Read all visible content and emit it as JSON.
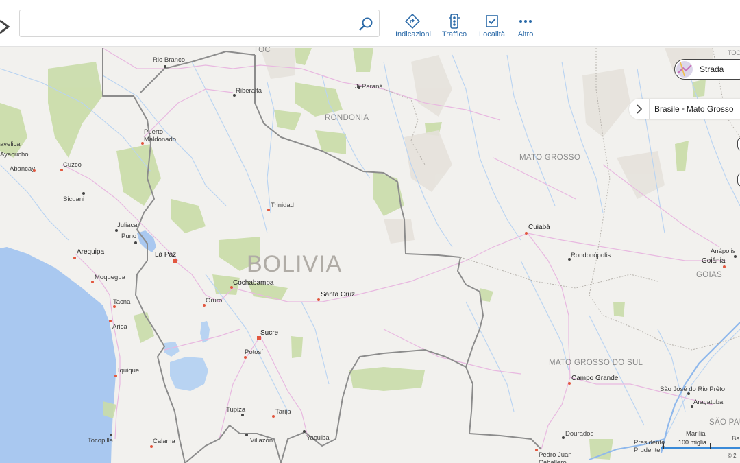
{
  "search": {
    "value": "",
    "placeholder": ""
  },
  "toolbar": {
    "directions": {
      "label": "Indicazioni",
      "icon": "directions-icon"
    },
    "traffic": {
      "label": "Traffico",
      "icon": "traffic-light-icon"
    },
    "places": {
      "label": "Località",
      "icon": "places-icon"
    },
    "more": {
      "label": "Altro",
      "icon": "more-dots-icon"
    }
  },
  "map_style": {
    "label": "Strada"
  },
  "breadcrumb": {
    "items": [
      "Brasile",
      "Mato Grosso"
    ]
  },
  "scale": {
    "label": "100 miglia"
  },
  "copyright": "© 2",
  "colors": {
    "water": "#a9c8f0",
    "land": "#f2f1ee",
    "park": "#c9dca8",
    "border": "#8c8c8c",
    "road": "#e8b8e0",
    "river": "#b8d3f2",
    "accent": "#2b6aa8"
  },
  "labels": {
    "country": "BOLIVIA",
    "regions": {
      "rondonia": "RONDONIA",
      "mato_grosso": "MATO GROSSO",
      "mato_grosso_do_sul": "MATO GROSSO DO SUL",
      "goias": "GOIAS",
      "sao_paulo": "SÃO PAU",
      "toc": "TOC",
      "toc2": "TOC"
    },
    "cities": {
      "rio_branco": "Rio Branco",
      "ji_parana": "Ji-Paraná",
      "riberalta": "Riberalta",
      "puerto_maldonado": "Puerto\nMaldonado",
      "huancavelica": "avelica",
      "ayacucho": "Ayacucho",
      "abancay": "Abancay",
      "cuzco": "Cuzco",
      "sicuani": "Sicuani",
      "trinidad": "Trinidad",
      "juliaca": "Juliaca",
      "puno": "Puno",
      "la_paz": "La Paz",
      "arequipa": "Arequipa",
      "moquegua": "Moquegua",
      "tacna": "Tacna",
      "arica": "Arica",
      "cochabamba": "Cochabamba",
      "oruro": "Oruro",
      "santa_cruz": "Santa Cruz",
      "sucre": "Sucre",
      "potosi": "Potosí",
      "iquique": "Iquique",
      "tupiza": "Tupiza",
      "tarija": "Tarija",
      "tocopilla": "Tocopilla",
      "calama": "Calama",
      "villazon": "Villazón",
      "yacuiba": "Yacuiba",
      "cuiaba": "Cuiabá",
      "rondonopolis": "Rondonópolis",
      "anapolis": "Anápolis",
      "goiania": "Goiânia",
      "campo_grande": "Campo Grande",
      "sao_jose_do_rio_preto": "São José do Rio Prêto",
      "aracatuba": "Araçatuba",
      "marilia": "Marília",
      "dourados": "Dourados",
      "presidente_prudente": "Presidente\nPrudente",
      "bauru": "Ba",
      "pedro_juan_caballero": "Pedro Juan\nCaballero"
    }
  }
}
